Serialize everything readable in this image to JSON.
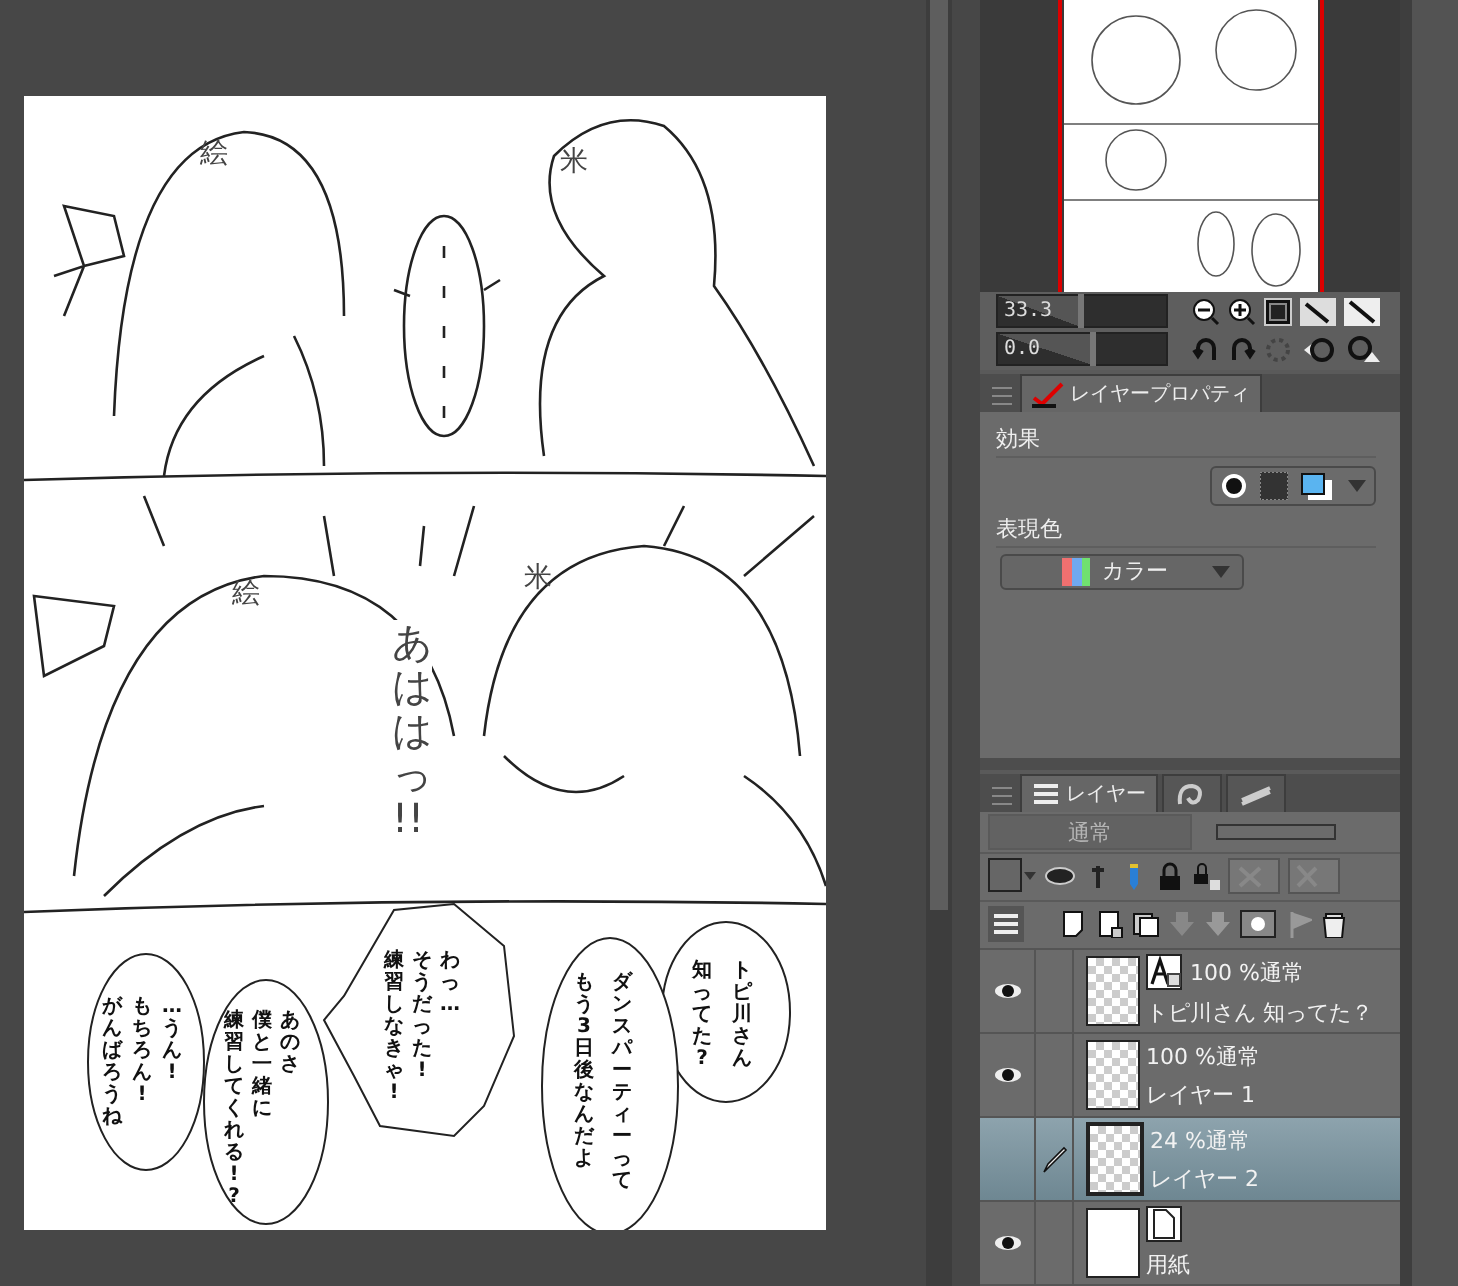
{
  "page": {
    "name_marks": [
      "絵",
      "米",
      "絵",
      "米"
    ],
    "sound_effect": "あははっ!!",
    "bubbles": [
      {
        "kind": "round",
        "text": "トピ川さん知ってた?"
      },
      {
        "kind": "round",
        "text": "ダンスパーティーってもう3日後なんだよ"
      },
      {
        "kind": "spiky",
        "text": "わっ…そうだった!練習しなきゃ!"
      },
      {
        "kind": "round",
        "text": "あのさ僕と一緒に練習してくれる!?"
      },
      {
        "kind": "round",
        "text": "…うん!もちろん!がんばろうね"
      }
    ]
  },
  "navigator": {
    "zoom": {
      "value": "33.3",
      "level": 0.48
    },
    "rotation": {
      "value": "0.0",
      "level": 0.55
    }
  },
  "layer_property": {
    "tab": "レイヤープロパティ",
    "effect_label": "効果",
    "color_label": "表現色",
    "color_mode": "カラー"
  },
  "layers_panel": {
    "tabs": [
      {
        "kind": "label",
        "label": "レイヤー",
        "selected": true
      },
      {
        "kind": "icon",
        "selected": false
      },
      {
        "kind": "icon",
        "selected": false
      }
    ],
    "blend_mode": {
      "value": "通常",
      "disabled": true
    },
    "layers": [
      {
        "kind": "text",
        "opacity": "100 %通常",
        "name": "トピ川さん 知ってた？",
        "visible": true,
        "editing": false,
        "selected": false
      },
      {
        "kind": "raster",
        "opacity": "100 %通常",
        "name": "レイヤー 1",
        "visible": true,
        "editing": false,
        "selected": false
      },
      {
        "kind": "raster",
        "opacity": "24 %通常",
        "name": "レイヤー 2",
        "visible": false,
        "editing": true,
        "selected": true
      },
      {
        "kind": "paper",
        "name": "用紙",
        "visible": true,
        "editing": false,
        "selected": false
      }
    ]
  }
}
